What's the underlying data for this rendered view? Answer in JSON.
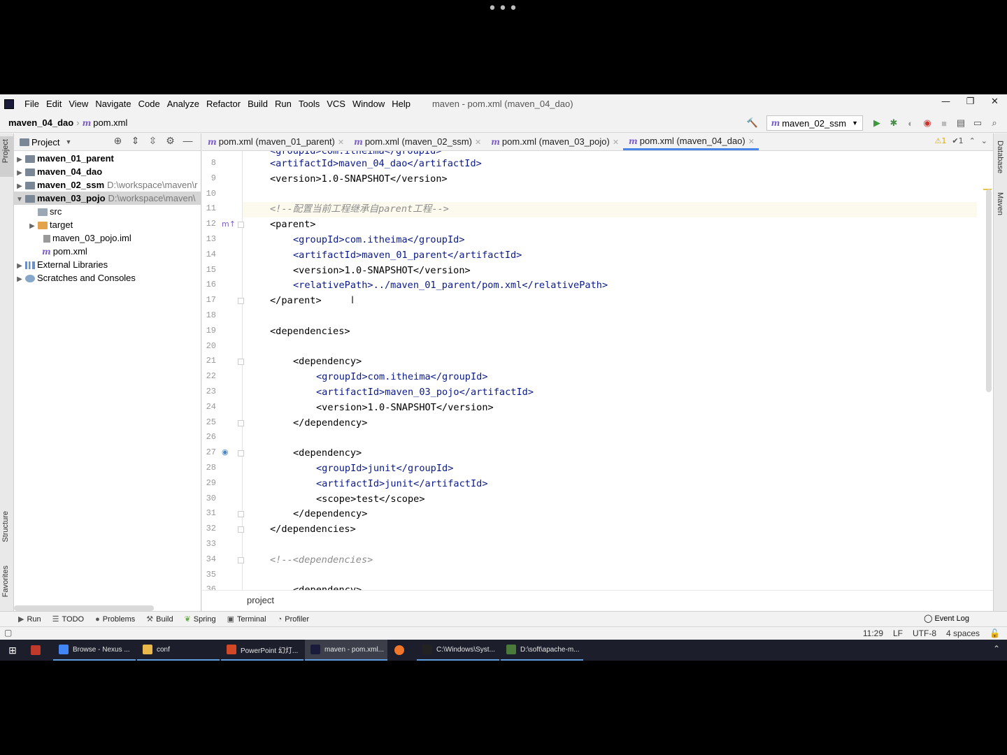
{
  "menubar": {
    "items": [
      "File",
      "Edit",
      "View",
      "Navigate",
      "Code",
      "Analyze",
      "Refactor",
      "Build",
      "Run",
      "Tools",
      "VCS",
      "Window",
      "Help"
    ],
    "window_title": "maven - pom.xml (maven_04_dao)"
  },
  "navbar": {
    "project": "maven_04_dao",
    "file": "pom.xml",
    "run_config": "maven_02_ssm"
  },
  "project_panel": {
    "title": "Project",
    "tree": [
      {
        "label": "maven_01_parent",
        "path": ""
      },
      {
        "label": "maven_04_dao",
        "path": ""
      },
      {
        "label": "maven_02_ssm",
        "path": "D:\\workspace\\maven\\r"
      },
      {
        "label": "maven_03_pojo",
        "path": "D:\\workspace\\maven\\"
      },
      {
        "label": "src",
        "path": ""
      },
      {
        "label": "target",
        "path": ""
      },
      {
        "label": "maven_03_pojo.iml",
        "path": ""
      },
      {
        "label": "pom.xml",
        "path": ""
      },
      {
        "label": "External Libraries",
        "path": ""
      },
      {
        "label": "Scratches and Consoles",
        "path": ""
      }
    ]
  },
  "editor": {
    "tabs": [
      {
        "label": "pom.xml (maven_01_parent)"
      },
      {
        "label": "pom.xml (maven_02_ssm)"
      },
      {
        "label": "pom.xml (maven_03_pojo)"
      },
      {
        "label": "pom.xml (maven_04_dao)"
      }
    ],
    "inspections": {
      "warnings": "1",
      "checks": "1"
    },
    "lines": [
      {
        "n": "8",
        "text": "<artifactId>maven_04_dao</artifactId>"
      },
      {
        "n": "9",
        "text": "<version>1.0-SNAPSHOT</version>"
      },
      {
        "n": "10",
        "text": ""
      },
      {
        "n": "11",
        "text": "<!--配置当前工程继承自parent工程-->"
      },
      {
        "n": "12",
        "text": "<parent>"
      },
      {
        "n": "13",
        "text": "<groupId>com.itheima</groupId>"
      },
      {
        "n": "14",
        "text": "<artifactId>maven_01_parent</artifactId>"
      },
      {
        "n": "15",
        "text": "<version>1.0-SNAPSHOT</version>"
      },
      {
        "n": "16",
        "text": "<relativePath>../maven_01_parent/pom.xml</relativePath>"
      },
      {
        "n": "17",
        "text": "</parent>"
      },
      {
        "n": "18",
        "text": ""
      },
      {
        "n": "19",
        "text": "<dependencies>"
      },
      {
        "n": "20",
        "text": ""
      },
      {
        "n": "21",
        "text": "<dependency>"
      },
      {
        "n": "22",
        "text": "<groupId>com.itheima</groupId>"
      },
      {
        "n": "23",
        "text": "<artifactId>maven_03_pojo</artifactId>"
      },
      {
        "n": "24",
        "text": "<version>1.0-SNAPSHOT</version>"
      },
      {
        "n": "25",
        "text": "</dependency>"
      },
      {
        "n": "26",
        "text": ""
      },
      {
        "n": "27",
        "text": "<dependency>"
      },
      {
        "n": "28",
        "text": "<groupId>junit</groupId>"
      },
      {
        "n": "29",
        "text": "<artifactId>junit</artifactId>"
      },
      {
        "n": "30",
        "text": "<scope>test</scope>"
      },
      {
        "n": "31",
        "text": "</dependency>"
      },
      {
        "n": "32",
        "text": "</dependencies>"
      },
      {
        "n": "33",
        "text": ""
      },
      {
        "n": "34",
        "text": "<!--<dependencies>"
      },
      {
        "n": "35",
        "text": ""
      },
      {
        "n": "36",
        "text": "<dependency>"
      }
    ],
    "breadcrumb": "project"
  },
  "side_strips": {
    "left": [
      "Project",
      "Structure",
      "Favorites"
    ],
    "right": [
      "Database",
      "Maven"
    ]
  },
  "toolwindows": [
    "Run",
    "TODO",
    "Problems",
    "Build",
    "Spring",
    "Terminal",
    "Profiler"
  ],
  "event_log": "Event Log",
  "status": {
    "position": "11:29",
    "line_sep": "LF",
    "encoding": "UTF-8",
    "indent": "4 spaces"
  },
  "taskbar": [
    {
      "label": "Browse - Nexus ...",
      "color": "#4285f4"
    },
    {
      "label": "conf",
      "color": "#e8b84a"
    },
    {
      "label": "PowerPoint 幻灯...",
      "color": "#d24726"
    },
    {
      "label": "maven - pom.xml...",
      "color": "#1a1a3a"
    },
    {
      "label": "",
      "color": "#f0762a"
    },
    {
      "label": "C:\\Windows\\Syst...",
      "color": "#222222"
    },
    {
      "label": "D:\\soft\\apache-m...",
      "color": "#4a7a3a"
    }
  ]
}
